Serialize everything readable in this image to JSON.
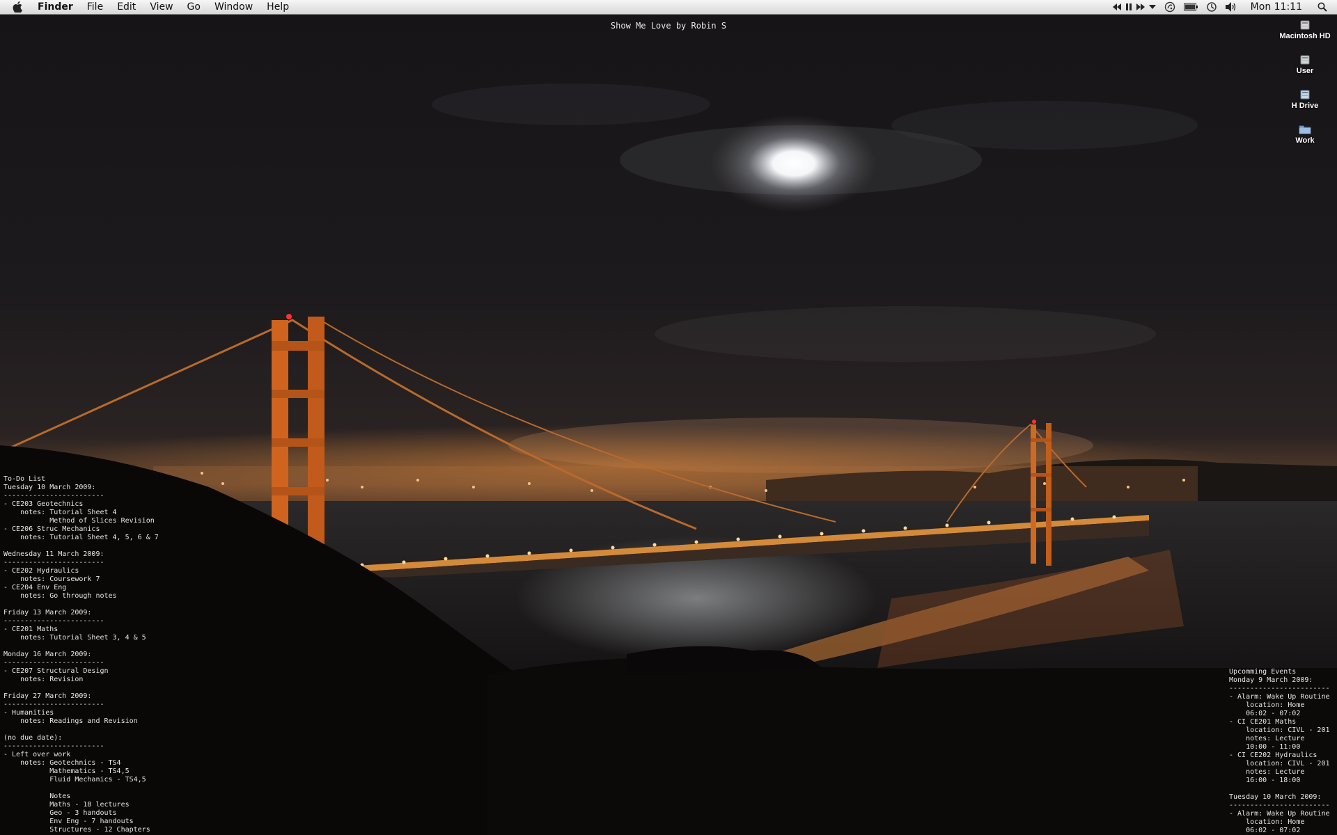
{
  "menubar": {
    "menus": [
      "Finder",
      "File",
      "Edit",
      "View",
      "Go",
      "Window",
      "Help"
    ],
    "clock": "Mon 11:11",
    "status_icons": [
      "rewind-icon",
      "pause-icon",
      "fast-forward-icon",
      "chevron-down-icon",
      "theme-icon",
      "battery-icon",
      "time-machine-icon",
      "volume-icon",
      "spotlight-search-icon"
    ]
  },
  "now_playing": "Show Me Love by Robin S",
  "desktop_icons": [
    {
      "label": "Macintosh HD",
      "icon": "hard-drive-icon"
    },
    {
      "label": "User",
      "icon": "drive-icon"
    },
    {
      "label": "H Drive",
      "icon": "network-drive-icon"
    },
    {
      "label": "Work",
      "icon": "folder-icon"
    }
  ],
  "todo_text": "To-Do List\nTuesday 10 March 2009:\n------------------------\n- CE203 Geotechnics\n    notes: Tutorial Sheet 4\n           Method of Slices Revision\n- CE206 Struc Mechanics\n    notes: Tutorial Sheet 4, 5, 6 & 7\n\nWednesday 11 March 2009:\n------------------------\n- CE202 Hydraulics\n    notes: Coursework 7\n- CE204 Env Eng\n    notes: Go through notes\n\nFriday 13 March 2009:\n------------------------\n- CE201 Maths\n    notes: Tutorial Sheet 3, 4 & 5\n\nMonday 16 March 2009:\n------------------------\n- CE207 Structural Design\n    notes: Revision\n\nFriday 27 March 2009:\n------------------------\n- Humanities\n    notes: Readings and Revision\n\n(no due date):\n------------------------\n- Left over work\n    notes: Geotechnics - TS4\n           Mathematics - TS4,5\n           Fluid Mechanics - TS4,5\n\n           Notes\n           Maths - 18 lectures\n           Geo - 3 handouts\n           Env Eng - 7 handouts\n           Structures - 12 Chapters",
  "events_text": "Upcomming Events\nMonday 9 March 2009:\n------------------------\n- Alarm: Wake Up Routine\n    location: Home\n    06:02 - 07:02\n- CI CE201 Maths\n    location: CIVL - 201\n    notes: Lecture\n    10:00 - 11:00\n- CI CE202 Hydraulics\n    location: CIVL - 201\n    notes: Lecture\n    16:00 - 18:00\n\nTuesday 10 March 2009:\n------------------------\n- Alarm: Wake Up Routine\n    location: Home\n    06:02 - 07:02"
}
